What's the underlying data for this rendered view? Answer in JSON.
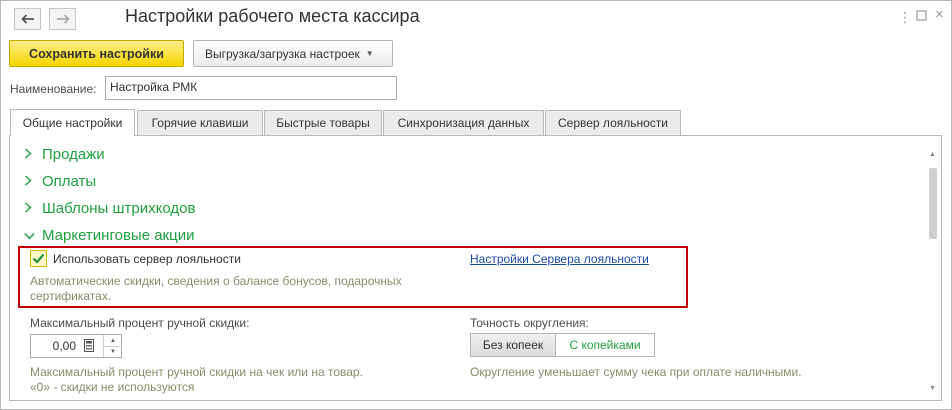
{
  "window": {
    "title": "Настройки рабочего места кассира",
    "back_icon": "arrow-left-icon",
    "forward_icon": "arrow-right-icon"
  },
  "toolbar": {
    "save_label": "Сохранить настройки",
    "export_label": "Выгрузка/загрузка настроек"
  },
  "name_field": {
    "label": "Наименование:",
    "value": "Настройка РМК"
  },
  "tabs": [
    {
      "label": "Общие настройки",
      "active": true
    },
    {
      "label": "Горячие клавиши",
      "active": false
    },
    {
      "label": "Быстрые товары",
      "active": false
    },
    {
      "label": "Синхронизация данных",
      "active": false
    },
    {
      "label": "Сервер лояльности",
      "active": false
    }
  ],
  "groups": [
    {
      "label": "Продажи",
      "expanded": false
    },
    {
      "label": "Оплаты",
      "expanded": false
    },
    {
      "label": "Шаблоны штрихкодов",
      "expanded": false
    },
    {
      "label": "Маркетинговые акции",
      "expanded": true
    }
  ],
  "loyalty": {
    "checkbox_label": "Использовать сервер лояльности",
    "checked": true,
    "hint_line1": "Автоматические скидки, сведения о балансе бонусов, подарочных",
    "hint_line2": "сертификатах.",
    "settings_link": "Настройки Сервера лояльности"
  },
  "max_discount": {
    "label": "Максимальный процент ручной скидки:",
    "value": "0,00",
    "hint_line1": "Максимальный процент ручной скидки на чек или на товар.",
    "hint_line2": "«0» - скидки не используются"
  },
  "rounding": {
    "label": "Точность округления:",
    "option_1": "Без копеек",
    "option_2": "С копейками",
    "selected": "option_2",
    "hint": "Округление уменьшает сумму чека при оплате наличными."
  },
  "colors": {
    "accent_green": "#20a040",
    "primary_yellow": "#f6d500",
    "highlight_red": "#c00000",
    "link_blue": "#1a4ba8"
  }
}
